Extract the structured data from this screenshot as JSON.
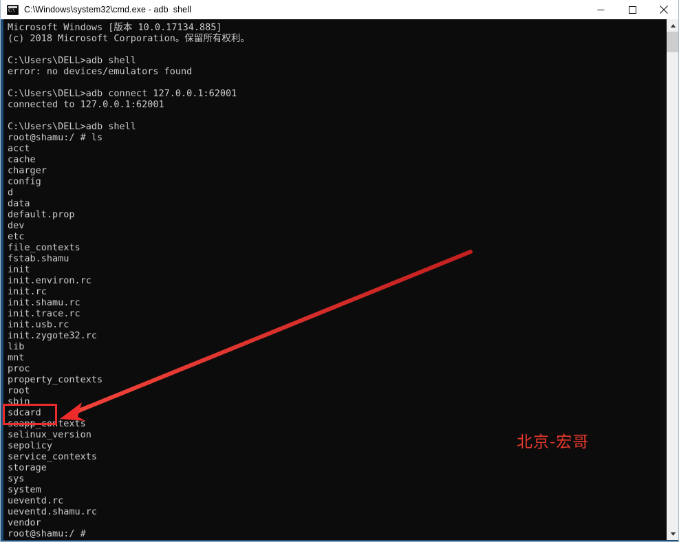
{
  "window": {
    "title": "C:\\Windows\\system32\\cmd.exe - adb  shell",
    "icon_text": "C:\\",
    "controls": {
      "minimize": "—",
      "maximize": "□",
      "close": "✕"
    }
  },
  "console": {
    "lines": [
      "Microsoft Windows [版本 10.0.17134.885]",
      "(c) 2018 Microsoft Corporation。保留所有权利。",
      "",
      "C:\\Users\\DELL>adb shell",
      "error: no devices/emulators found",
      "",
      "C:\\Users\\DELL>adb connect 127.0.0.1:62001",
      "connected to 127.0.0.1:62001",
      "",
      "C:\\Users\\DELL>adb shell",
      "root@shamu:/ # ls",
      "acct",
      "cache",
      "charger",
      "config",
      "d",
      "data",
      "default.prop",
      "dev",
      "etc",
      "file_contexts",
      "fstab.shamu",
      "init",
      "init.environ.rc",
      "init.rc",
      "init.shamu.rc",
      "init.trace.rc",
      "init.usb.rc",
      "init.zygote32.rc",
      "lib",
      "mnt",
      "proc",
      "property_contexts",
      "root",
      "sbin",
      "sdcard",
      "seapp_contexts",
      "selinux_version",
      "sepolicy",
      "service_contexts",
      "storage",
      "sys",
      "system",
      "ueventd.rc",
      "ueventd.shamu.rc",
      "vendor",
      "root@shamu:/ #"
    ]
  },
  "annotations": {
    "watermark_text": "北京-宏哥",
    "highlight_target": "sdcard",
    "colors": {
      "annotation_red": "#ee2b2b",
      "watermark_red": "#e8392e",
      "console_background": "#0c0c0c",
      "console_foreground": "#cccccc",
      "window_border_blue": "#1f4e79"
    }
  },
  "scrollbar": {
    "up_arrow": "▲",
    "down_arrow": "▼"
  }
}
